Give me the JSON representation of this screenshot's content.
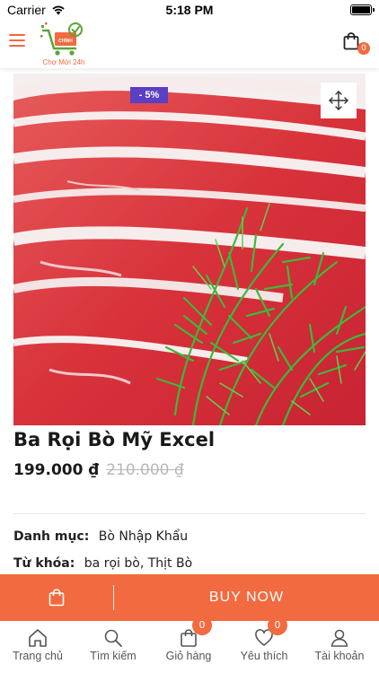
{
  "status_bar": {
    "carrier": "Carrier",
    "time": "5:18 PM"
  },
  "header": {
    "logo_text": "Chợ Mới 24h",
    "cart_count": "0",
    "accent_color": "#f26a3f"
  },
  "product": {
    "discount": "- 5%",
    "name": "Ba Rọi Bò Mỹ Excel",
    "price": "199.000 ₫",
    "old_price": "210.000 ₫",
    "category_label": "Danh mục:",
    "category_value": "Bò Nhập Khẩu",
    "keywords_label": "Từ khóa:",
    "keywords_value": "ba rọi bò, Thịt Bò"
  },
  "action_bar": {
    "buy_now_label": "BUY NOW"
  },
  "tab_bar": {
    "items": [
      {
        "label": "Trang chủ",
        "icon": "home-icon"
      },
      {
        "label": "Tìm kiếm",
        "icon": "search-icon"
      },
      {
        "label": "Giỏ hàng",
        "icon": "bag-icon",
        "badge": "0"
      },
      {
        "label": "Yêu thích",
        "icon": "heart-icon",
        "badge": "0"
      },
      {
        "label": "Tài khoản",
        "icon": "user-icon"
      }
    ]
  }
}
